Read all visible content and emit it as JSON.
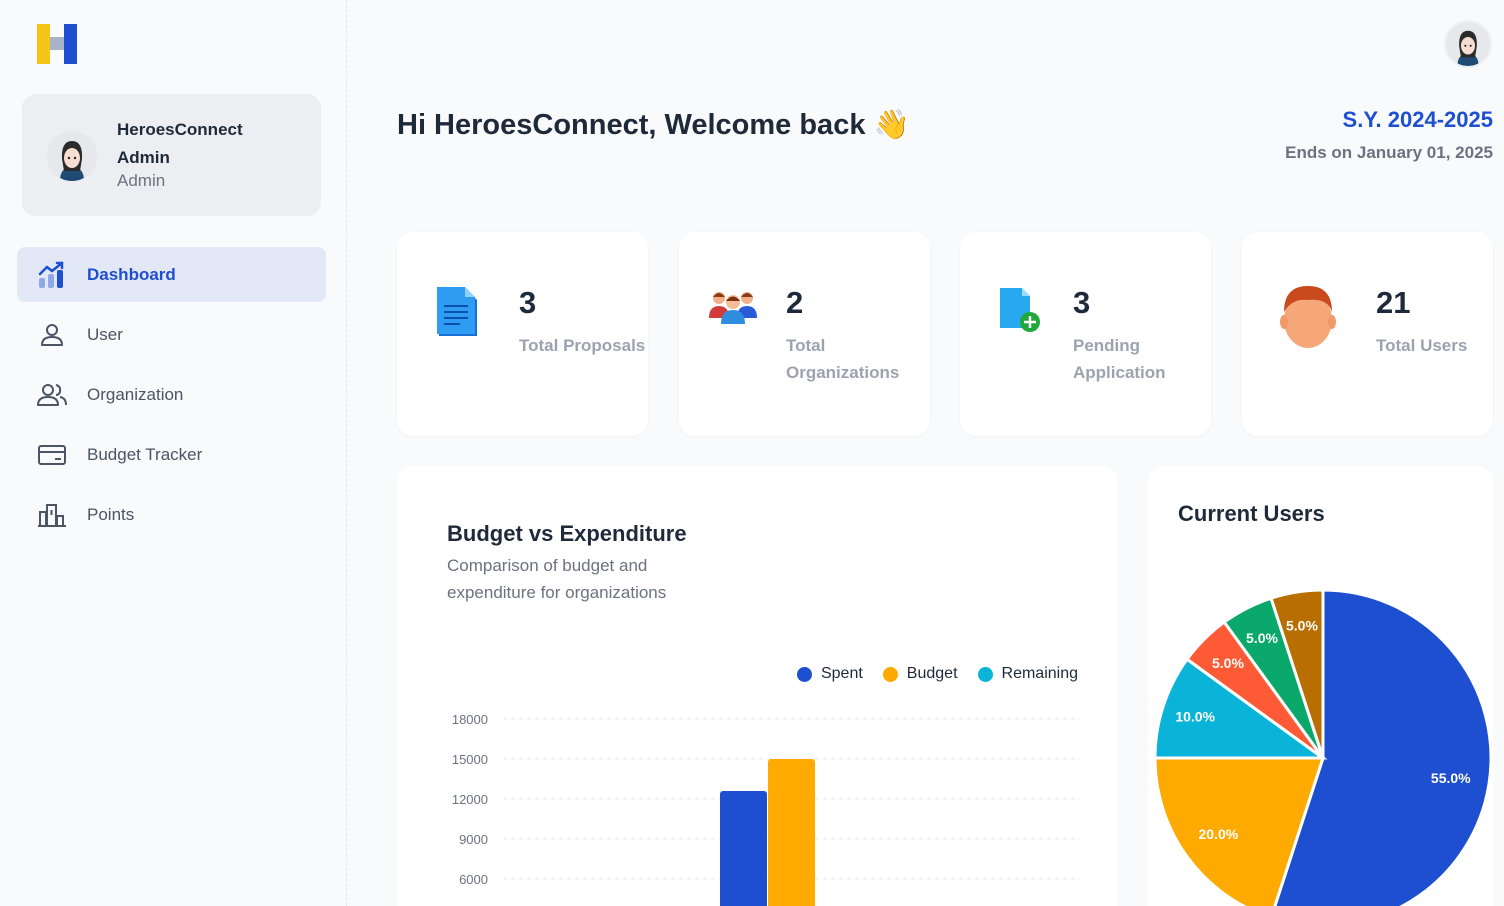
{
  "sidebar": {
    "profile": {
      "name": "HeroesConnect Admin",
      "role": "Admin"
    },
    "nav": [
      {
        "label": "Dashboard",
        "icon": "chart-growth-icon",
        "active": true
      },
      {
        "label": "User",
        "icon": "user-icon",
        "active": false
      },
      {
        "label": "Organization",
        "icon": "users-icon",
        "active": false
      },
      {
        "label": "Budget Tracker",
        "icon": "credit-card-icon",
        "active": false
      },
      {
        "label": "Points",
        "icon": "building-chart-icon",
        "active": false
      }
    ]
  },
  "header": {
    "welcome": "Hi HeroesConnect, Welcome back 👋",
    "school_year": "S.Y. 2024-2025",
    "ends_on": "Ends on January 01, 2025"
  },
  "stats": [
    {
      "value": "3",
      "label": "Total Proposals",
      "icon": "document-icon"
    },
    {
      "value": "2",
      "label": "Total Organizations",
      "icon": "group-icon"
    },
    {
      "value": "3",
      "label": "Pending Application",
      "icon": "add-file-icon"
    },
    {
      "value": "21",
      "label": "Total Users",
      "icon": "user-face-icon"
    }
  ],
  "budget": {
    "title": "Budget vs Expenditure",
    "subtitle": "Comparison of budget and expenditure for organizations"
  },
  "users_panel": {
    "title": "Current Users"
  },
  "colors": {
    "accent": "#1e4fd1",
    "spent": "#1e4fd1",
    "budget": "#ffaa00",
    "remaining": "#0ab4d8"
  },
  "chart_data": [
    {
      "type": "bar",
      "title": "Budget vs Expenditure",
      "subtitle": "Comparison of budget and expenditure for organizations",
      "legend_position": "top-right",
      "grid": true,
      "y_ticks": [
        6000,
        9000,
        12000,
        15000,
        18000
      ],
      "ylim": [
        6000,
        18000
      ],
      "series": [
        {
          "name": "Spent",
          "color": "#1e4fd1",
          "values": [
            12600
          ]
        },
        {
          "name": "Budget",
          "color": "#ffaa00",
          "values": [
            15000
          ]
        },
        {
          "name": "Remaining",
          "color": "#0ab4d8",
          "values": [
            0
          ]
        }
      ]
    },
    {
      "type": "pie",
      "title": "Current Users",
      "slices": [
        {
          "value": 55.0,
          "label": "55.0%",
          "color": "#1e4fd1"
        },
        {
          "value": 20.0,
          "label": "20.0%",
          "color": "#ffaa00"
        },
        {
          "value": 10.0,
          "label": "10.0%",
          "color": "#0ab4d8"
        },
        {
          "value": 5.0,
          "label": "5.0%",
          "color": "#ff5a36"
        },
        {
          "value": 5.0,
          "label": "5.0%",
          "color": "#0aa86a"
        },
        {
          "value": 5.0,
          "label": "5.0%",
          "color": "#b86e00"
        }
      ]
    }
  ]
}
